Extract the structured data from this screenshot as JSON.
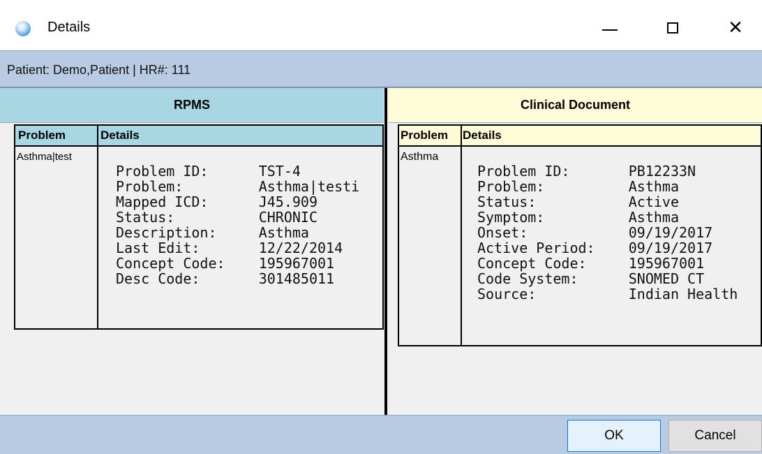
{
  "window": {
    "title": "Details",
    "icon": "app-globe-icon"
  },
  "patient_bar": {
    "text": "Patient: Demo,Patient | HR#: 111"
  },
  "left_panel": {
    "title": "RPMS",
    "columns": [
      "Problem",
      "Details"
    ],
    "problem": "Asthma|test",
    "details": [
      {
        "label": "Problem ID:",
        "value": "TST-4"
      },
      {
        "label": "Problem:",
        "value": "Asthma|testi"
      },
      {
        "label": "Mapped ICD:",
        "value": "J45.909"
      },
      {
        "label": "Status:",
        "value": "CHRONIC"
      },
      {
        "label": "Description:",
        "value": "Asthma"
      },
      {
        "label": "Last Edit:",
        "value": "12/22/2014"
      },
      {
        "label": "Concept Code:",
        "value": "195967001"
      },
      {
        "label": "Desc Code:",
        "value": "301485011"
      }
    ]
  },
  "right_panel": {
    "title": "Clinical Document",
    "columns": [
      "Problem",
      "Details"
    ],
    "problem": "Asthma",
    "details": [
      {
        "label": "Problem ID:",
        "value": "PB12233N"
      },
      {
        "label": "Problem:",
        "value": "Asthma"
      },
      {
        "label": "Status:",
        "value": "Active"
      },
      {
        "label": "Symptom:",
        "value": "Asthma"
      },
      {
        "label": "Onset:",
        "value": "09/19/2017"
      },
      {
        "label": "Active Period:",
        "value": "09/19/2017"
      },
      {
        "label": "Concept Code:",
        "value": "195967001"
      },
      {
        "label": "Code System:",
        "value": "SNOMED CT"
      },
      {
        "label": "Source:",
        "value": "Indian Health"
      }
    ]
  },
  "buttons": {
    "ok": "OK",
    "cancel": "Cancel"
  },
  "colors": {
    "header_bar": "#b9cbe2",
    "rpms_header": "#a9d6e3",
    "clinical_header": "#fdfbd8"
  }
}
